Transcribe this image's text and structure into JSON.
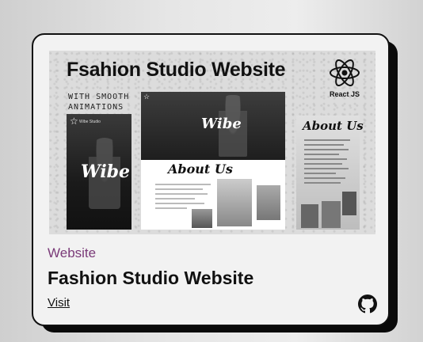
{
  "thumbnail": {
    "heading": "Fsahion Studio Website",
    "subheading_line1": "WITH SMOOTH",
    "subheading_line2": "ANIMATIONS",
    "framework_label": "React JS",
    "brand_small": "Wibe Studio",
    "logo_word": "Wibe",
    "about_heading": "About Us",
    "accent_color": "#61dafb"
  },
  "card": {
    "category": "Website",
    "title": "Fashion Studio Website",
    "link_label": "Visit",
    "category_color": "#7a3a78",
    "repo_icon": "github-icon"
  }
}
